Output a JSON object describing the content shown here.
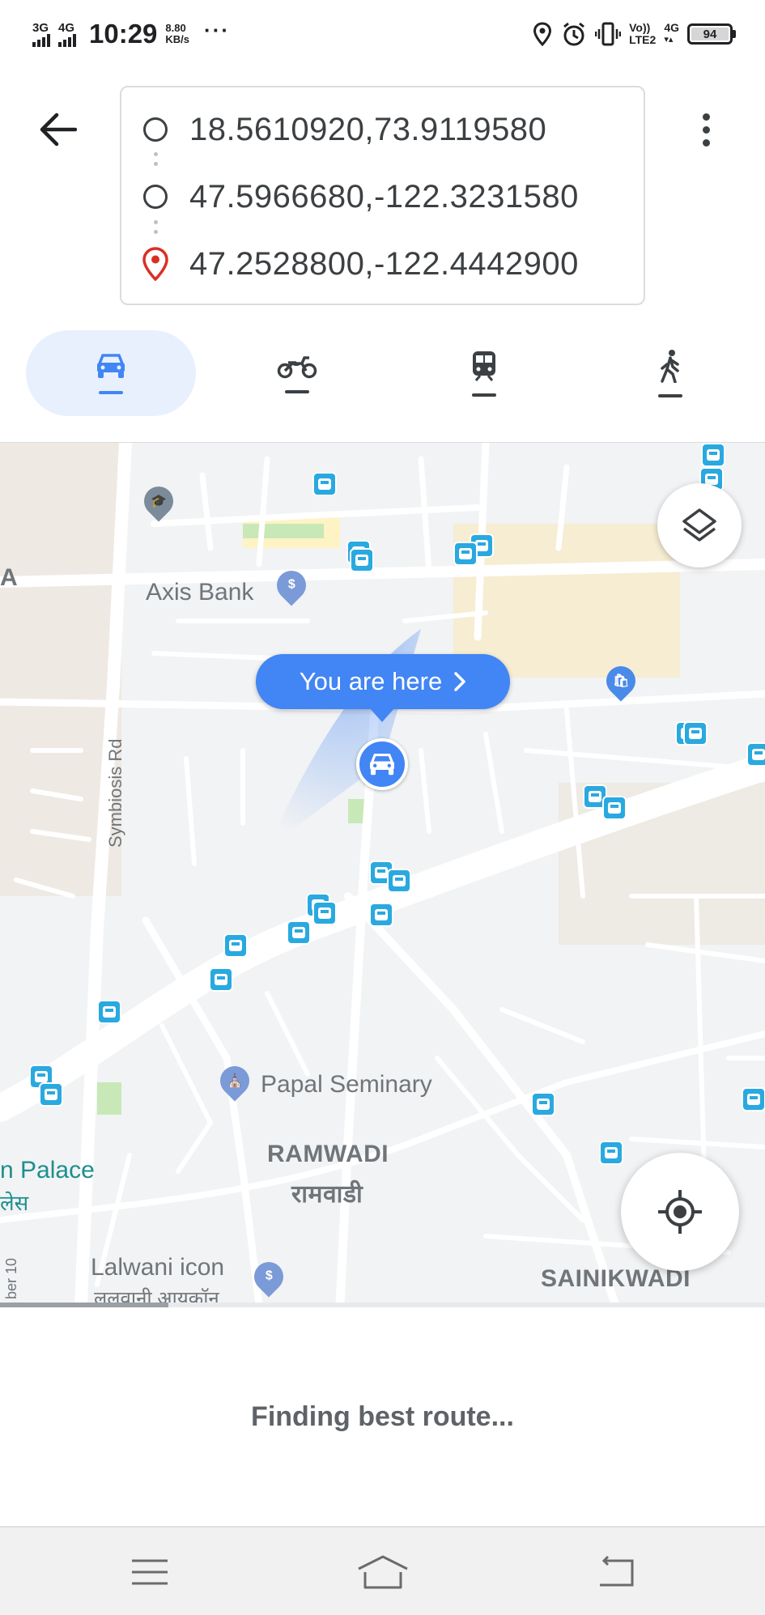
{
  "status_bar": {
    "sig1": "3G",
    "sig2": "4G",
    "time": "10:29",
    "speed_value": "8.80",
    "speed_unit": "KB/s",
    "dots": "···",
    "volte_line1": "Vo))",
    "volte_line2": "LTE2",
    "net2": "4G",
    "battery_percent": "94"
  },
  "route": {
    "waypoints": [
      {
        "text": "18.5610920,73.9119580"
      },
      {
        "text": "47.5966680,-122.3231580"
      },
      {
        "text": "47.2528800,-122.4442900"
      }
    ]
  },
  "modes": [
    {
      "name": "car",
      "active": true
    },
    {
      "name": "motorcycle",
      "active": false
    },
    {
      "name": "transit",
      "active": false
    },
    {
      "name": "walking",
      "active": false
    }
  ],
  "map": {
    "you_are_here": "You are here",
    "labels": {
      "axis_bank": "Axis Bank",
      "symbiosis_rd": "Symbiosis Rd",
      "papal_seminary": "Papal Seminary",
      "ramwadi": "RAMWADI",
      "ramwadi_hi": "रामवाडी",
      "palace": "n Palace",
      "palace_hi": "लेस",
      "lalwani": "Lalwani icon",
      "lalwani_hi": "ललवानी आयकॉन",
      "sainikwadi": "SAINIKWADI",
      "edge_a": "A",
      "edge_ber": "ber 10"
    },
    "colors": {
      "map_bg": "#f1f3f4",
      "road": "#ffffff",
      "accent": "#4285f4",
      "bus": "#29a9e0"
    }
  },
  "bottom": {
    "status": "Finding best route...",
    "progress": 0.22
  }
}
